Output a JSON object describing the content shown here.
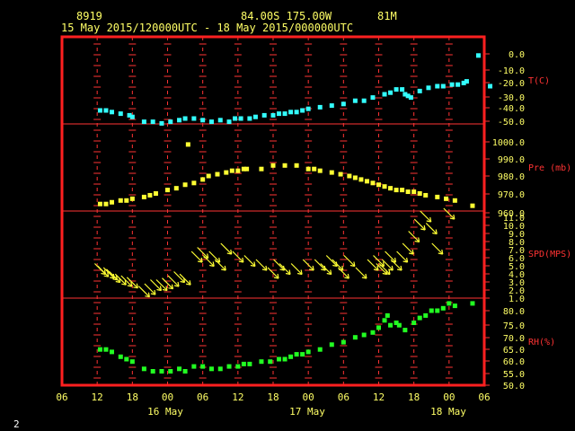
{
  "header": {
    "station": "8919",
    "location": "84.00S  175.00W",
    "elevation": "81M",
    "period": "15 May 2015/120000UTC - 18 May 2015/000000UTC"
  },
  "footer": {
    "page": "2"
  },
  "colors": {
    "frame": "#ff2020",
    "grid": "#ff3333",
    "text": "#ffff66",
    "temp": "#33ffff",
    "pres": "#ffff33",
    "wind": "#ffff33",
    "rh": "#22ff22"
  },
  "chart_data": {
    "type": "scatter",
    "x_ticks": [
      "06",
      "12",
      "18",
      "00",
      "06",
      "12",
      "18",
      "00",
      "06",
      "12",
      "18",
      "00",
      "06"
    ],
    "date_labels": [
      "16 May",
      "17 May",
      "18 May"
    ],
    "panels": [
      {
        "name": "T(C)",
        "ylabel": "T(C)",
        "yticks": [
          "0.0",
          "-10.0",
          "-20.0",
          "-30.0",
          "-40.0",
          "-50.0"
        ],
        "ylim": [
          -50,
          0
        ],
        "points": [
          [
            12.5,
            -35
          ],
          [
            13.5,
            -35
          ],
          [
            14.5,
            -36
          ],
          [
            16,
            -37
          ],
          [
            17.5,
            -38
          ],
          [
            18,
            -39
          ],
          [
            20,
            -42
          ],
          [
            21.5,
            -42
          ],
          [
            23,
            -43
          ],
          [
            24.5,
            -42
          ],
          [
            26,
            -41
          ],
          [
            27,
            -40
          ],
          [
            28.5,
            -40
          ],
          [
            30,
            -41
          ],
          [
            31.5,
            -42
          ],
          [
            33,
            -41
          ],
          [
            34.5,
            -42
          ],
          [
            35.5,
            -40
          ],
          [
            36.5,
            -40
          ],
          [
            38,
            -40
          ],
          [
            39,
            -39
          ],
          [
            40.5,
            -38
          ],
          [
            42,
            -38
          ],
          [
            43,
            -37
          ],
          [
            44,
            -37
          ],
          [
            45,
            -36
          ],
          [
            46,
            -36
          ],
          [
            47,
            -35
          ],
          [
            48,
            -34
          ],
          [
            50,
            -33
          ],
          [
            52,
            -32
          ],
          [
            54,
            -31
          ],
          [
            56,
            -29
          ],
          [
            57.5,
            -29
          ],
          [
            59,
            -27
          ],
          [
            61,
            -25
          ],
          [
            62,
            -24
          ],
          [
            63,
            -22
          ],
          [
            64,
            -22
          ],
          [
            64.5,
            -25
          ],
          [
            65,
            -26
          ],
          [
            65.5,
            -27
          ],
          [
            67,
            -23
          ],
          [
            68.5,
            -21
          ],
          [
            70,
            -20
          ],
          [
            71,
            -20
          ],
          [
            72.5,
            -19
          ],
          [
            73.5,
            -19
          ],
          [
            74.5,
            -18
          ],
          [
            75,
            -17
          ],
          [
            77,
            -1
          ],
          [
            79,
            -20
          ]
        ]
      },
      {
        "name": "Pre (mb)",
        "ylabel": "Pre (mb)",
        "yticks": [
          "1000.0",
          "990.0",
          "980.0",
          "970.0",
          "960.0"
        ],
        "ylim": [
          960,
          1000
        ],
        "points": [
          [
            12.5,
            964
          ],
          [
            13.5,
            964
          ],
          [
            14.5,
            965
          ],
          [
            16,
            966
          ],
          [
            17,
            966
          ],
          [
            18,
            967
          ],
          [
            20,
            968
          ],
          [
            21,
            969
          ],
          [
            22,
            970
          ],
          [
            24,
            972
          ],
          [
            25.5,
            973
          ],
          [
            27,
            975
          ],
          [
            27.5,
            998
          ],
          [
            28.5,
            976
          ],
          [
            30,
            978
          ],
          [
            31,
            980
          ],
          [
            32.5,
            981
          ],
          [
            34,
            982
          ],
          [
            35,
            983
          ],
          [
            36,
            983
          ],
          [
            37,
            984
          ],
          [
            37.5,
            984
          ],
          [
            40,
            984
          ],
          [
            42,
            986
          ],
          [
            44,
            986
          ],
          [
            46,
            986
          ],
          [
            48,
            984
          ],
          [
            49,
            984
          ],
          [
            50,
            983
          ],
          [
            52,
            982
          ],
          [
            53.5,
            981
          ],
          [
            55,
            980
          ],
          [
            56,
            979
          ],
          [
            57,
            978
          ],
          [
            58,
            977
          ],
          [
            59,
            976
          ],
          [
            60,
            975
          ],
          [
            61,
            974
          ],
          [
            62,
            973
          ],
          [
            63,
            972
          ],
          [
            64,
            972
          ],
          [
            65,
            971
          ],
          [
            66,
            971
          ],
          [
            67,
            970
          ],
          [
            68,
            969
          ],
          [
            70,
            968
          ],
          [
            71.5,
            967
          ],
          [
            73,
            966
          ],
          [
            76,
            963
          ]
        ]
      },
      {
        "name": "SPD(MPS)",
        "ylabel": "SPD(MPS)",
        "yticks": [
          "11.0",
          "10.0",
          "9.0",
          "8.0",
          "7.0",
          "6.0",
          "5.0",
          "4.0",
          "3.0",
          "2.0",
          "1.0"
        ],
        "ylim": [
          1,
          11
        ],
        "points": [
          [
            12.5,
            4.5
          ],
          [
            13,
            4.2
          ],
          [
            14,
            4
          ],
          [
            14.5,
            3.8
          ],
          [
            15,
            3.5
          ],
          [
            16,
            3.2
          ],
          [
            17,
            3
          ],
          [
            18,
            2.8
          ],
          [
            20,
            1.7
          ],
          [
            21,
            2
          ],
          [
            22,
            2.5
          ],
          [
            23,
            2.5
          ],
          [
            24,
            2.7
          ],
          [
            25,
            3
          ],
          [
            26,
            3.5
          ],
          [
            27,
            3.2
          ],
          [
            29,
            6
          ],
          [
            30,
            6.5
          ],
          [
            31,
            5.5
          ],
          [
            32,
            6
          ],
          [
            33,
            5
          ],
          [
            34,
            7
          ],
          [
            36,
            6
          ],
          [
            38,
            5.5
          ],
          [
            40,
            5
          ],
          [
            42,
            4
          ],
          [
            43,
            5
          ],
          [
            44,
            4.5
          ],
          [
            46,
            4.5
          ],
          [
            48,
            5
          ],
          [
            50,
            5
          ],
          [
            51,
            4.5
          ],
          [
            52,
            5.5
          ],
          [
            53,
            5
          ],
          [
            54,
            4
          ],
          [
            55,
            5.5
          ],
          [
            57,
            4
          ],
          [
            59,
            5
          ],
          [
            60,
            5.5
          ],
          [
            60.5,
            4.5
          ],
          [
            61,
            4.5
          ],
          [
            61.5,
            5
          ],
          [
            62,
            6
          ],
          [
            63,
            5
          ],
          [
            64,
            6
          ],
          [
            65,
            7
          ],
          [
            66,
            8.5
          ],
          [
            67,
            10
          ],
          [
            68,
            11
          ],
          [
            69,
            9.5
          ],
          [
            70,
            7
          ],
          [
            72,
            12
          ]
        ]
      },
      {
        "name": "RH(%)",
        "ylabel": "RH(%)",
        "yticks": [
          "80.0",
          "75.0",
          "70.0",
          "65.0",
          "60.0",
          "55.0",
          "50.0"
        ],
        "ylim": [
          50,
          80
        ],
        "points": [
          [
            12.5,
            64
          ],
          [
            13.5,
            64
          ],
          [
            14.5,
            63
          ],
          [
            16,
            61
          ],
          [
            17,
            60
          ],
          [
            18,
            59
          ],
          [
            20,
            56
          ],
          [
            21.5,
            55
          ],
          [
            23,
            55
          ],
          [
            24.5,
            55
          ],
          [
            26,
            56
          ],
          [
            27,
            55
          ],
          [
            28.5,
            57
          ],
          [
            30,
            57
          ],
          [
            31.5,
            56
          ],
          [
            33,
            56
          ],
          [
            34.5,
            57
          ],
          [
            36,
            57
          ],
          [
            37,
            58
          ],
          [
            38,
            58
          ],
          [
            40,
            59
          ],
          [
            41.5,
            59
          ],
          [
            43,
            60
          ],
          [
            44,
            60
          ],
          [
            45,
            61
          ],
          [
            46,
            62
          ],
          [
            47,
            62
          ],
          [
            48,
            63
          ],
          [
            50,
            64
          ],
          [
            52,
            66
          ],
          [
            54,
            67
          ],
          [
            56,
            69
          ],
          [
            57.5,
            70
          ],
          [
            59,
            71
          ],
          [
            60,
            73
          ],
          [
            61,
            76
          ],
          [
            61.5,
            78
          ],
          [
            62,
            74
          ],
          [
            63,
            75
          ],
          [
            63.5,
            74
          ],
          [
            64.5,
            72
          ],
          [
            66,
            75
          ],
          [
            67,
            77
          ],
          [
            68,
            78
          ],
          [
            69,
            80
          ],
          [
            70,
            80
          ],
          [
            71,
            81
          ],
          [
            72,
            83
          ],
          [
            73,
            82
          ],
          [
            76,
            83
          ]
        ]
      }
    ]
  }
}
